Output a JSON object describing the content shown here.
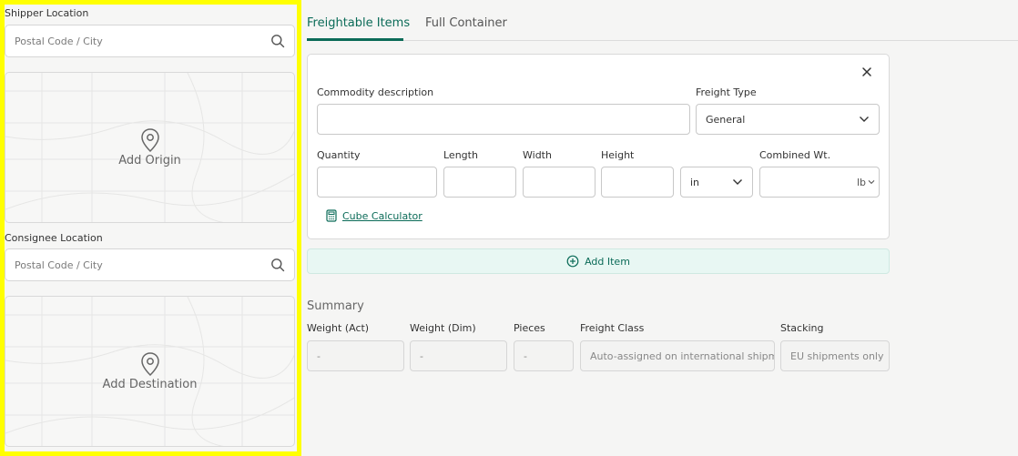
{
  "shipper": {
    "label": "Shipper Location",
    "placeholder": "Postal Code / City",
    "map_text": "Add Origin"
  },
  "consignee": {
    "label": "Consignee Location",
    "placeholder": "Postal Code / City",
    "map_text": "Add Destination"
  },
  "tabs": [
    {
      "label": "Freightable Items",
      "active": true
    },
    {
      "label": "Full Container",
      "active": false
    }
  ],
  "item": {
    "commodity_label": "Commodity description",
    "freight_type_label": "Freight Type",
    "freight_type_value": "General",
    "quantity_label": "Quantity",
    "length_label": "Length",
    "width_label": "Width",
    "height_label": "Height",
    "unit_value": "in",
    "combined_wt_label": "Combined Wt.",
    "weight_unit": "lb",
    "cube_calculator": "Cube Calculator"
  },
  "add_item_label": "Add Item",
  "summary": {
    "title": "Summary",
    "weight_act_label": "Weight (Act)",
    "weight_act_value": "-",
    "weight_dim_label": "Weight (Dim)",
    "weight_dim_value": "-",
    "pieces_label": "Pieces",
    "pieces_value": "-",
    "freight_class_label": "Freight Class",
    "freight_class_value": "Auto-assigned on international shipments",
    "stacking_label": "Stacking",
    "stacking_value": "EU shipments only"
  },
  "colors": {
    "accent": "#0b6b58",
    "highlight": "#ffff00",
    "add_item_bg": "#e8f7f3"
  }
}
